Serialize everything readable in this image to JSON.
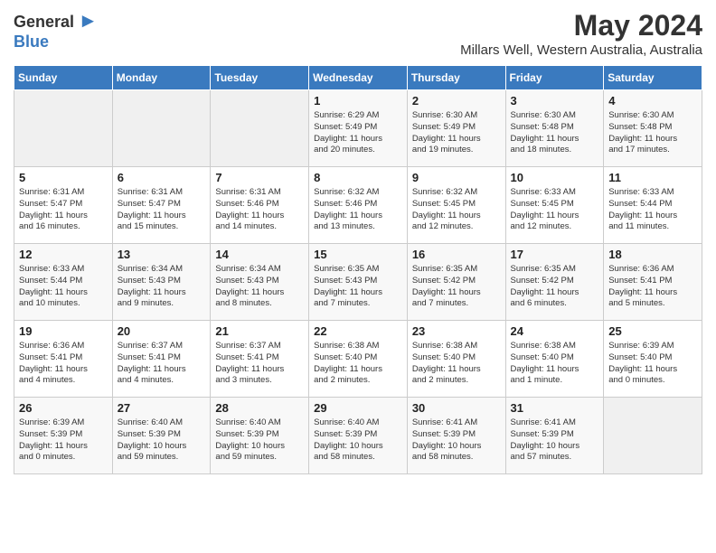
{
  "header": {
    "logo_general": "General",
    "logo_blue": "Blue",
    "title": "May 2024",
    "subtitle": "Millars Well, Western Australia, Australia"
  },
  "weekdays": [
    "Sunday",
    "Monday",
    "Tuesday",
    "Wednesday",
    "Thursday",
    "Friday",
    "Saturday"
  ],
  "weeks": [
    [
      {
        "num": "",
        "info": ""
      },
      {
        "num": "",
        "info": ""
      },
      {
        "num": "",
        "info": ""
      },
      {
        "num": "1",
        "info": "Sunrise: 6:29 AM\nSunset: 5:49 PM\nDaylight: 11 hours\nand 20 minutes."
      },
      {
        "num": "2",
        "info": "Sunrise: 6:30 AM\nSunset: 5:49 PM\nDaylight: 11 hours\nand 19 minutes."
      },
      {
        "num": "3",
        "info": "Sunrise: 6:30 AM\nSunset: 5:48 PM\nDaylight: 11 hours\nand 18 minutes."
      },
      {
        "num": "4",
        "info": "Sunrise: 6:30 AM\nSunset: 5:48 PM\nDaylight: 11 hours\nand 17 minutes."
      }
    ],
    [
      {
        "num": "5",
        "info": "Sunrise: 6:31 AM\nSunset: 5:47 PM\nDaylight: 11 hours\nand 16 minutes."
      },
      {
        "num": "6",
        "info": "Sunrise: 6:31 AM\nSunset: 5:47 PM\nDaylight: 11 hours\nand 15 minutes."
      },
      {
        "num": "7",
        "info": "Sunrise: 6:31 AM\nSunset: 5:46 PM\nDaylight: 11 hours\nand 14 minutes."
      },
      {
        "num": "8",
        "info": "Sunrise: 6:32 AM\nSunset: 5:46 PM\nDaylight: 11 hours\nand 13 minutes."
      },
      {
        "num": "9",
        "info": "Sunrise: 6:32 AM\nSunset: 5:45 PM\nDaylight: 11 hours\nand 12 minutes."
      },
      {
        "num": "10",
        "info": "Sunrise: 6:33 AM\nSunset: 5:45 PM\nDaylight: 11 hours\nand 12 minutes."
      },
      {
        "num": "11",
        "info": "Sunrise: 6:33 AM\nSunset: 5:44 PM\nDaylight: 11 hours\nand 11 minutes."
      }
    ],
    [
      {
        "num": "12",
        "info": "Sunrise: 6:33 AM\nSunset: 5:44 PM\nDaylight: 11 hours\nand 10 minutes."
      },
      {
        "num": "13",
        "info": "Sunrise: 6:34 AM\nSunset: 5:43 PM\nDaylight: 11 hours\nand 9 minutes."
      },
      {
        "num": "14",
        "info": "Sunrise: 6:34 AM\nSunset: 5:43 PM\nDaylight: 11 hours\nand 8 minutes."
      },
      {
        "num": "15",
        "info": "Sunrise: 6:35 AM\nSunset: 5:43 PM\nDaylight: 11 hours\nand 7 minutes."
      },
      {
        "num": "16",
        "info": "Sunrise: 6:35 AM\nSunset: 5:42 PM\nDaylight: 11 hours\nand 7 minutes."
      },
      {
        "num": "17",
        "info": "Sunrise: 6:35 AM\nSunset: 5:42 PM\nDaylight: 11 hours\nand 6 minutes."
      },
      {
        "num": "18",
        "info": "Sunrise: 6:36 AM\nSunset: 5:41 PM\nDaylight: 11 hours\nand 5 minutes."
      }
    ],
    [
      {
        "num": "19",
        "info": "Sunrise: 6:36 AM\nSunset: 5:41 PM\nDaylight: 11 hours\nand 4 minutes."
      },
      {
        "num": "20",
        "info": "Sunrise: 6:37 AM\nSunset: 5:41 PM\nDaylight: 11 hours\nand 4 minutes."
      },
      {
        "num": "21",
        "info": "Sunrise: 6:37 AM\nSunset: 5:41 PM\nDaylight: 11 hours\nand 3 minutes."
      },
      {
        "num": "22",
        "info": "Sunrise: 6:38 AM\nSunset: 5:40 PM\nDaylight: 11 hours\nand 2 minutes."
      },
      {
        "num": "23",
        "info": "Sunrise: 6:38 AM\nSunset: 5:40 PM\nDaylight: 11 hours\nand 2 minutes."
      },
      {
        "num": "24",
        "info": "Sunrise: 6:38 AM\nSunset: 5:40 PM\nDaylight: 11 hours\nand 1 minute."
      },
      {
        "num": "25",
        "info": "Sunrise: 6:39 AM\nSunset: 5:40 PM\nDaylight: 11 hours\nand 0 minutes."
      }
    ],
    [
      {
        "num": "26",
        "info": "Sunrise: 6:39 AM\nSunset: 5:39 PM\nDaylight: 11 hours\nand 0 minutes."
      },
      {
        "num": "27",
        "info": "Sunrise: 6:40 AM\nSunset: 5:39 PM\nDaylight: 10 hours\nand 59 minutes."
      },
      {
        "num": "28",
        "info": "Sunrise: 6:40 AM\nSunset: 5:39 PM\nDaylight: 10 hours\nand 59 minutes."
      },
      {
        "num": "29",
        "info": "Sunrise: 6:40 AM\nSunset: 5:39 PM\nDaylight: 10 hours\nand 58 minutes."
      },
      {
        "num": "30",
        "info": "Sunrise: 6:41 AM\nSunset: 5:39 PM\nDaylight: 10 hours\nand 58 minutes."
      },
      {
        "num": "31",
        "info": "Sunrise: 6:41 AM\nSunset: 5:39 PM\nDaylight: 10 hours\nand 57 minutes."
      },
      {
        "num": "",
        "info": ""
      }
    ]
  ]
}
